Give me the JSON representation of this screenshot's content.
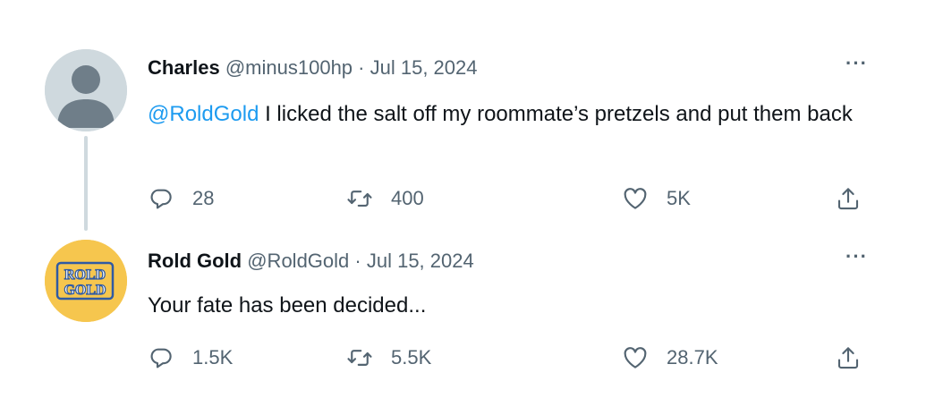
{
  "tweets": [
    {
      "display_name": "Charles",
      "handle": "@minus100hp",
      "separator": " · ",
      "date": "Jul 15, 2024",
      "mention": "@RoldGold",
      "text": " I licked the salt off my roommate’s pretzels and put them back",
      "replies": "28",
      "retweets": "400",
      "likes": "5K",
      "more": "···",
      "avatar_icon": "default-person-avatar"
    },
    {
      "display_name": "Rold Gold",
      "handle": "@RoldGold",
      "separator": " · ",
      "date": "Jul 15, 2024",
      "mention": "",
      "text": "Your fate has been decided...",
      "replies": "1.5K",
      "retweets": "5.5K",
      "likes": "28.7K",
      "more": "···",
      "avatar_logo_text": [
        "ROLD",
        "GOLD"
      ],
      "avatar_color": "#f6c64e"
    }
  ],
  "colors": {
    "accent": "#1d9bf0",
    "secondary_text": "#536471",
    "primary_text": "#0f1419",
    "thread_line": "#cfd9de"
  }
}
